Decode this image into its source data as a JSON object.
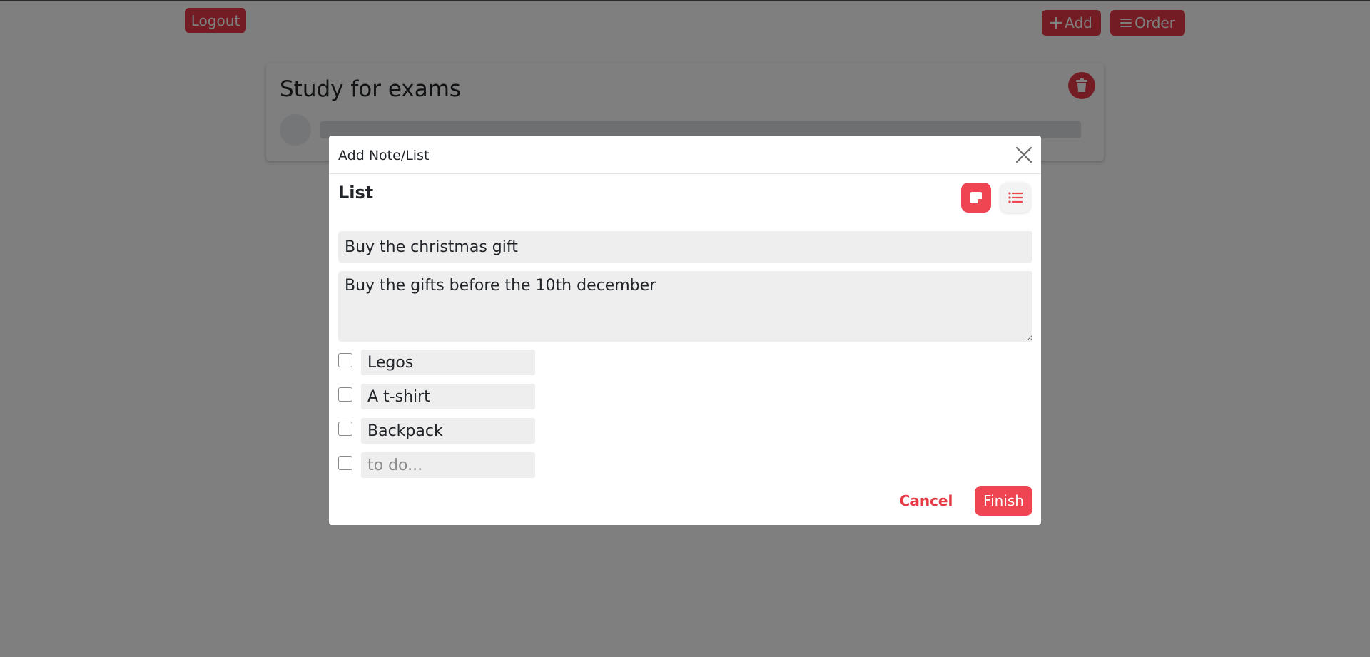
{
  "topbar": {
    "logout_label": "Logout",
    "add_label": "Add",
    "order_label": "Order"
  },
  "notes": [
    {
      "title": "Study for exams"
    }
  ],
  "modal": {
    "title": "Add Note/List",
    "type_label": "List",
    "title_value": "Buy the christmas gift",
    "description_value": "Buy the gifts before the 10th december",
    "items": [
      {
        "text": "Legos",
        "checked": false
      },
      {
        "text": "A t-shirt",
        "checked": false
      },
      {
        "text": "Backpack",
        "checked": false
      }
    ],
    "new_item_placeholder": "to do...",
    "cancel_label": "Cancel",
    "finish_label": "Finish"
  },
  "icons": {
    "add": "plus-icon",
    "order": "menu-icon",
    "delete": "trash-icon",
    "close": "close-icon",
    "note_type": "sticky-note-icon",
    "list_type": "list-icon"
  },
  "colors": {
    "accent": "#e63946",
    "accent_light": "#ef4452",
    "backdrop": "rgba(0,0,0,0.5)",
    "input_bg": "#eeeeee"
  }
}
